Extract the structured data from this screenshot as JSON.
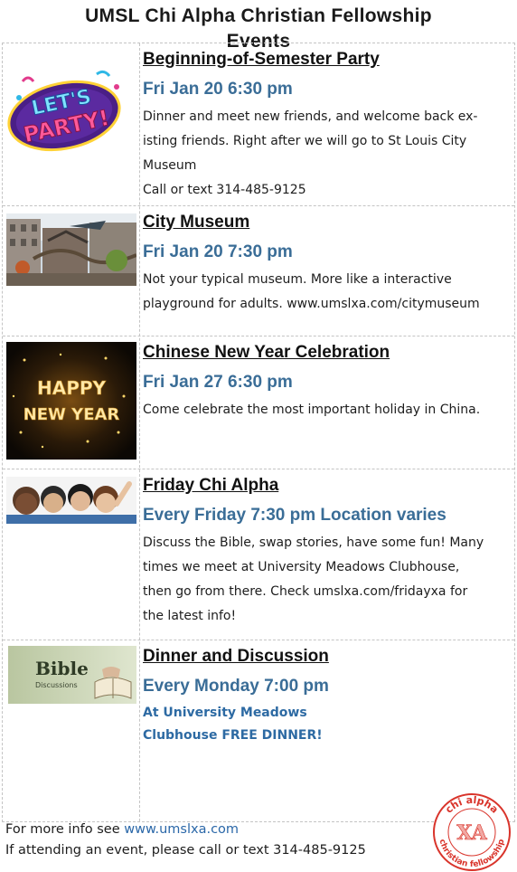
{
  "page": {
    "title_line1": "UMSL Chi Alpha Christian Fellowship",
    "title_line2": "Events"
  },
  "events": [
    {
      "title": "Beginning-of-Semester Party",
      "date": "Fri Jan 20 6:30 pm",
      "desc": [
        "Dinner and meet new friends, and welcome back ex-",
        "isting friends.  Right after we will go to St Louis City",
        "Museum",
        "Call or text 314-485-9125"
      ],
      "image_text": [
        "LET'S",
        "PARTY!"
      ]
    },
    {
      "title": "City Museum",
      "date": "Fri Jan 20 7:30 pm",
      "desc": [
        "Not your typical museum.  More like a interactive",
        "playground for adults.  www.umslxa.com/citymuseum"
      ]
    },
    {
      "title": "Chinese New Year Celebration",
      "date": "Fri Jan 27 6:30 pm",
      "desc": [
        "Come celebrate the most important holiday in China."
      ],
      "image_text": [
        "HAPPY",
        "NEW YEAR"
      ]
    },
    {
      "title": "Friday Chi Alpha",
      "date": "Every Friday 7:30 pm  Location varies",
      "desc": [
        "Discuss the Bible, swap stories, have some fun! Many",
        "times we meet at University Meadows Clubhouse,",
        "then go from there.  Check umslxa.com/fridayxa for",
        "the latest info!"
      ]
    },
    {
      "title": "Dinner and Discussion",
      "date": "Every Monday 7:00 pm",
      "desc": [
        "At University Meadows",
        "Clubhouse   FREE DINNER!"
      ],
      "image_text": [
        "Bible",
        "Discussions"
      ]
    }
  ],
  "footer": {
    "line1_prefix": "For more info see ",
    "line1_link": "www.umslxa.com",
    "line2": "If attending an event, please call or text 314-485-9125"
  },
  "logo": {
    "top_text": "chi alpha",
    "letters": "XA",
    "bottom_text": "christian fellowship"
  },
  "colors": {
    "date_blue": "#3a6d97",
    "link_blue": "#2a67a8",
    "logo_red": "#d9342b"
  }
}
